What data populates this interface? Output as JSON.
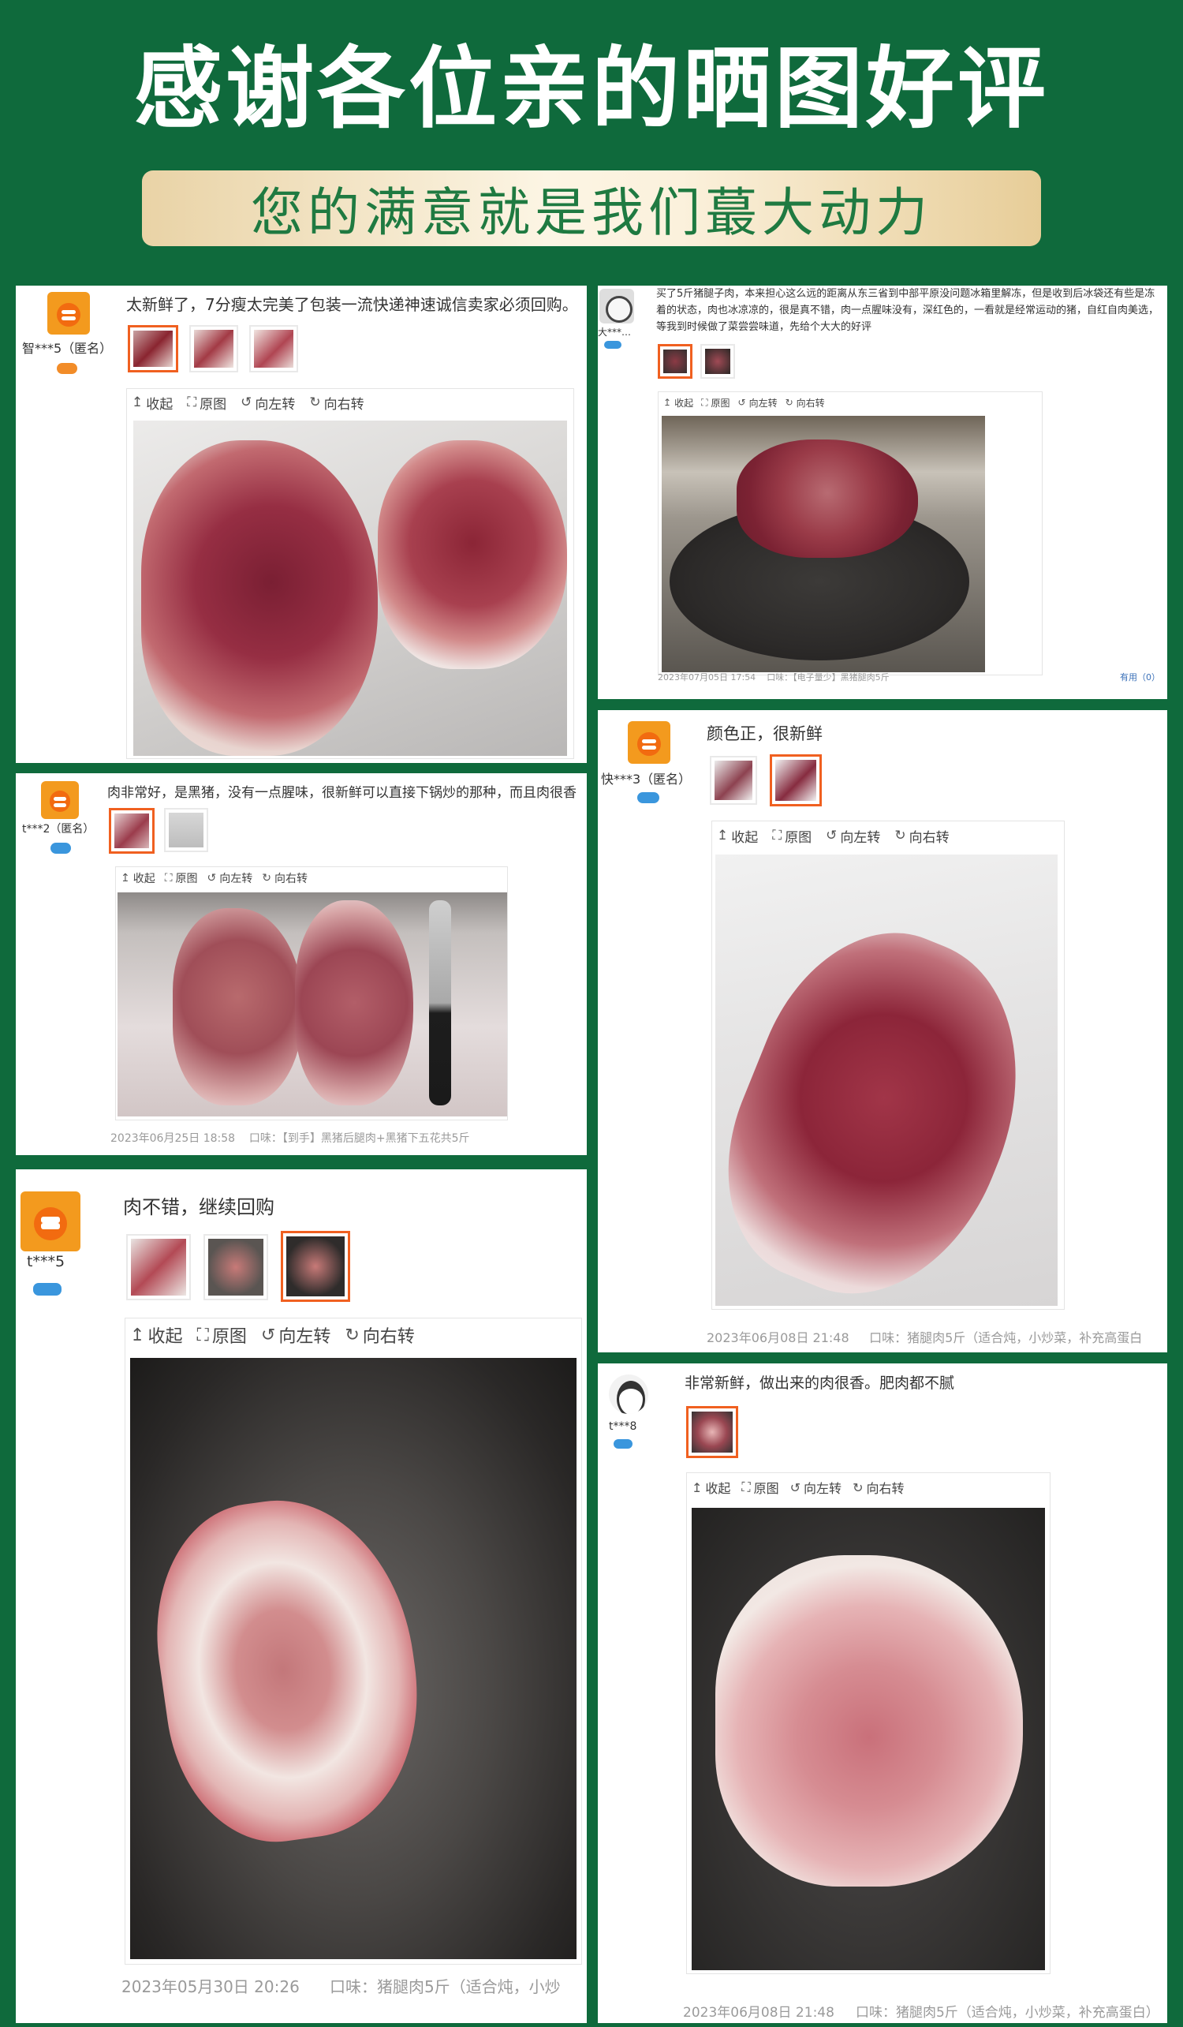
{
  "header": {
    "title": "感谢各位亲的晒图好评",
    "subtitle": "您的满意就是我们蕞大动力"
  },
  "toolbar_labels": {
    "collapse": "收起",
    "original": "原图",
    "rotate_left": "向左转",
    "rotate_right": "向右转"
  },
  "reviews": [
    {
      "user": "智***5（匿名）",
      "text": "太新鲜了，7分瘦太完美了包装一流快递神速诚信卖家必须回购。",
      "date": "",
      "variant": ""
    },
    {
      "user": "大***…",
      "text": "买了5斤猪腿子肉，本来担心这么远的距离从东三省到中部平原没问题冰箱里解冻，但是收到后冰袋还有些是冻着的状态，肉也冰凉凉的，很是真不错，肉一点腥味没有，深红色的，一看就是经常运动的猪，自红自肉美选，等我到时候做了菜尝尝味道，先给个大大的好评",
      "date": "2023年07月05日 17:54",
      "variant": "口味：【电子量少】黑猪腿肉5斤",
      "useful": "有用（0）"
    },
    {
      "user": "t***2（匿名）",
      "text": "肉非常好，是黑猪，没有一点腥味，很新鲜可以直接下锅炒的那种，而且肉很香",
      "date": "2023年06月25日 18:58",
      "variant": "口味：【到手】黑猪后腿肉+黑猪下五花共5斤"
    },
    {
      "user": "快***3（匿名）",
      "text": "颜色正，很新鲜",
      "date": "2023年06月08日 21:48",
      "variant": "口味：猪腿肉5斤（适合炖，小炒菜，补充高蛋白"
    },
    {
      "user": "t***5",
      "text": "肉不错，继续回购",
      "date": "2023年05月30日 20:26",
      "variant": "口味：猪腿肉5斤（适合炖，小炒"
    },
    {
      "user": "t***8",
      "text": "非常新鲜，做出来的肉很香。肥肉都不腻",
      "date": "2023年06月08日 21:48",
      "variant": "口味：猪腿肉5斤（适合炖，小炒菜，补充高蛋白）"
    }
  ],
  "icons": {
    "collapse": "collapse-icon",
    "original": "original-icon",
    "rotate_left": "rotate-left-icon",
    "rotate_right": "rotate-right-icon"
  },
  "colors": {
    "background": "#0f6a3c",
    "subtitle_text": "#1f7a41",
    "accent": "#f06020"
  }
}
